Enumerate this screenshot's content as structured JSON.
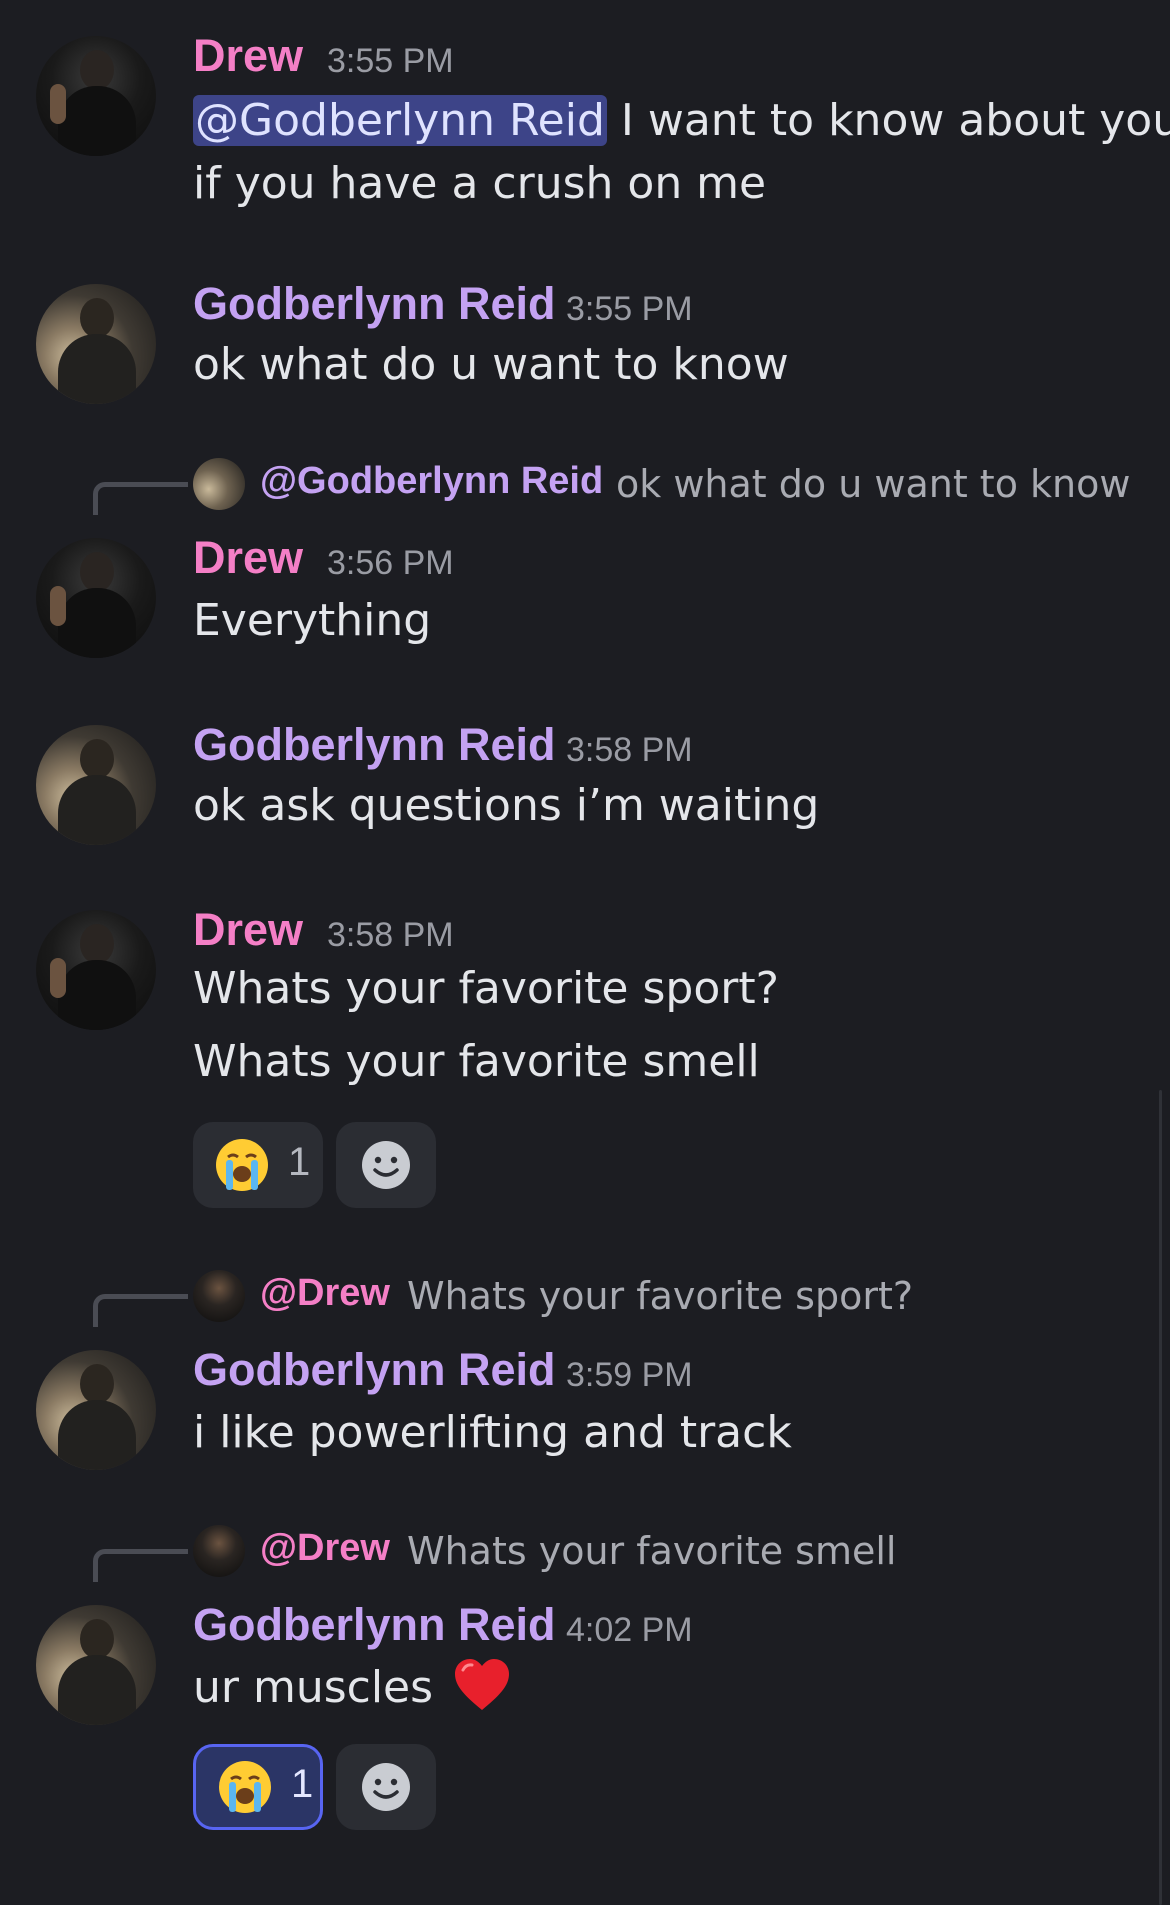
{
  "messages": [
    {
      "author": "Drew",
      "time": "3:55 PM",
      "mention": "@Godberlynn Reid",
      "line1_rest": " I want to know about you",
      "line2": "if you have a crush on me"
    },
    {
      "author": "Godberlynn Reid",
      "time": "3:55 PM",
      "text": "ok what do u want to know"
    },
    {
      "reply": {
        "name": "@Godberlynn Reid",
        "snippet": "ok what do u want to know"
      },
      "author": "Drew",
      "time": "3:56 PM",
      "text": "Everything"
    },
    {
      "author": "Godberlynn Reid",
      "time": "3:58 PM",
      "text": "ok ask questions i’m waiting"
    },
    {
      "author": "Drew",
      "time": "3:58 PM",
      "line1": "Whats your favorite sport?",
      "line2": "Whats your favorite smell",
      "reaction": {
        "emoji": "loudly-crying-face",
        "count": "1",
        "reacted_by_me": false
      }
    },
    {
      "reply": {
        "name": "@Drew",
        "snippet": "Whats your favorite sport?"
      },
      "author": "Godberlynn Reid",
      "time": "3:59 PM",
      "text": "i like powerlifting and track"
    },
    {
      "reply": {
        "name": "@Drew",
        "snippet": "Whats your favorite smell"
      },
      "author": "Godberlynn Reid",
      "time": "4:02 PM",
      "text": "ur muscles",
      "emoji": "red-heart",
      "reaction": {
        "emoji": "loudly-crying-face",
        "count": "1",
        "reacted_by_me": true
      }
    }
  ],
  "colors": {
    "background": "#1c1d22",
    "drew_name": "#f47fc6",
    "godberlynn_name": "#c4a2f2",
    "mention_bg": "#3d4488",
    "reaction_me_border": "#5865f2"
  }
}
